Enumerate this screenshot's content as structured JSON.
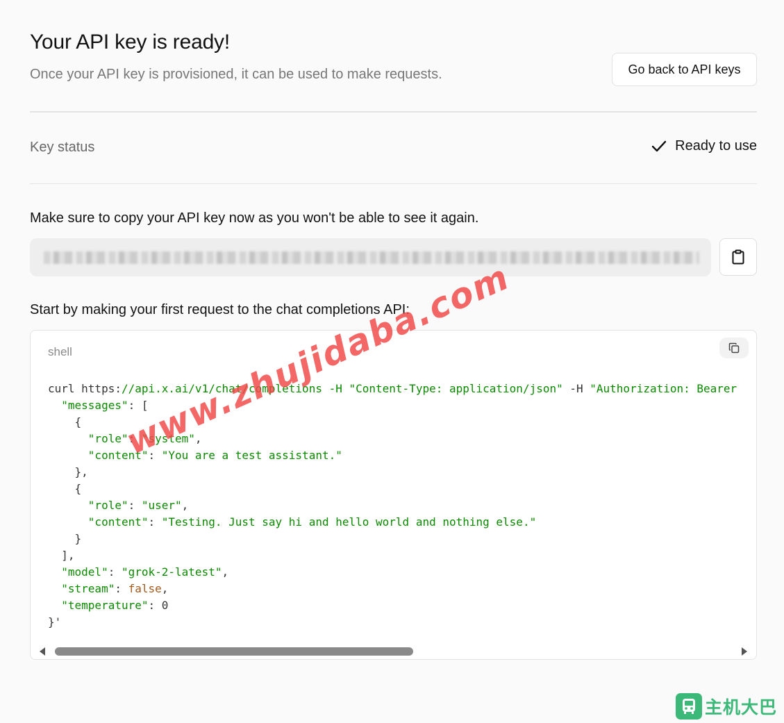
{
  "header": {
    "title": "Your API key is ready!",
    "subtitle": "Once your API key is provisioned, it can be used to make requests.",
    "back_button_label": "Go back to API keys"
  },
  "key_status": {
    "label": "Key status",
    "value": "Ready to use",
    "icon": "check-icon"
  },
  "api_key": {
    "warning": "Make sure to copy your API key now as you won't be able to see it again.",
    "value_state": "redacted (blurred)",
    "copy_icon": "clipboard-icon"
  },
  "code_sample": {
    "heading": "Start by making your first request to the chat completions API:",
    "language": "shell",
    "copy_icon": "copy-icon",
    "lines": [
      [
        {
          "t": "curl https:",
          "c": "plain"
        },
        {
          "t": "//api.x.ai/v1/chat/completions -H ",
          "c": "str"
        },
        {
          "t": "\"Content-Type: application/json\"",
          "c": "str"
        },
        {
          "t": " -H ",
          "c": "plain"
        },
        {
          "t": "\"Authorization: Bearer",
          "c": "str"
        }
      ],
      [
        {
          "t": "  ",
          "c": "plain"
        },
        {
          "t": "\"messages\"",
          "c": "str"
        },
        {
          "t": ": [",
          "c": "plain"
        }
      ],
      [
        {
          "t": "    {",
          "c": "plain"
        }
      ],
      [
        {
          "t": "      ",
          "c": "plain"
        },
        {
          "t": "\"role\"",
          "c": "str"
        },
        {
          "t": ": ",
          "c": "plain"
        },
        {
          "t": "\"system\"",
          "c": "str"
        },
        {
          "t": ",",
          "c": "plain"
        }
      ],
      [
        {
          "t": "      ",
          "c": "plain"
        },
        {
          "t": "\"content\"",
          "c": "str"
        },
        {
          "t": ": ",
          "c": "plain"
        },
        {
          "t": "\"You are a test assistant.\"",
          "c": "str"
        }
      ],
      [
        {
          "t": "    },",
          "c": "plain"
        }
      ],
      [
        {
          "t": "    {",
          "c": "plain"
        }
      ],
      [
        {
          "t": "      ",
          "c": "plain"
        },
        {
          "t": "\"role\"",
          "c": "str"
        },
        {
          "t": ": ",
          "c": "plain"
        },
        {
          "t": "\"user\"",
          "c": "str"
        },
        {
          "t": ",",
          "c": "plain"
        }
      ],
      [
        {
          "t": "      ",
          "c": "plain"
        },
        {
          "t": "\"content\"",
          "c": "str"
        },
        {
          "t": ": ",
          "c": "plain"
        },
        {
          "t": "\"Testing. Just say hi and hello world and nothing else.\"",
          "c": "str"
        }
      ],
      [
        {
          "t": "    }",
          "c": "plain"
        }
      ],
      [
        {
          "t": "  ],",
          "c": "plain"
        }
      ],
      [
        {
          "t": "  ",
          "c": "plain"
        },
        {
          "t": "\"model\"",
          "c": "str"
        },
        {
          "t": ": ",
          "c": "plain"
        },
        {
          "t": "\"grok-2-latest\"",
          "c": "str"
        },
        {
          "t": ",",
          "c": "plain"
        }
      ],
      [
        {
          "t": "  ",
          "c": "plain"
        },
        {
          "t": "\"stream\"",
          "c": "str"
        },
        {
          "t": ": ",
          "c": "plain"
        },
        {
          "t": "false",
          "c": "bool"
        },
        {
          "t": ",",
          "c": "plain"
        }
      ],
      [
        {
          "t": "  ",
          "c": "plain"
        },
        {
          "t": "\"temperature\"",
          "c": "str"
        },
        {
          "t": ": 0",
          "c": "plain"
        }
      ],
      [
        {
          "t": "}'",
          "c": "plain"
        }
      ]
    ],
    "horizontal_scroll_position": 0
  },
  "watermark": {
    "text": "www.zhujidaba.com"
  },
  "brand": {
    "text": "主机大巴",
    "icon": "bus-icon",
    "color": "#3cb878"
  },
  "colors": {
    "string": "#0b8a00",
    "boolean": "#a3581c",
    "watermark": "#f04646"
  }
}
